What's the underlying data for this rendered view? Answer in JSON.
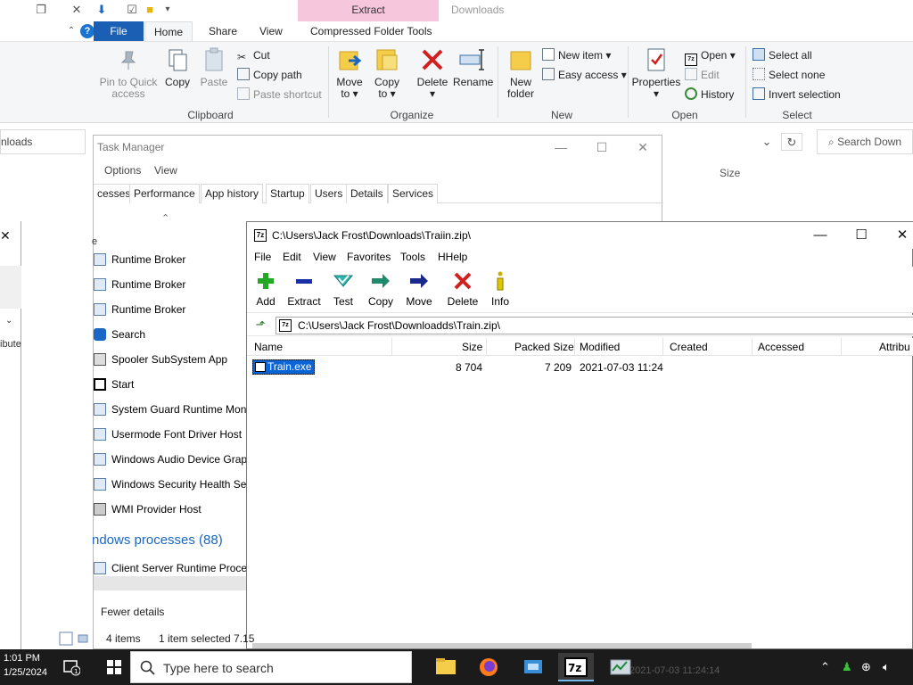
{
  "explorer": {
    "context_tab": "Extract",
    "window_title": "Downloads",
    "tabs": {
      "file": "File",
      "home": "Home",
      "share": "Share",
      "view": "View",
      "compressed": "Compressed Folder Tools"
    },
    "clipboard": {
      "pin": "Pin to Quick access",
      "copy": "Copy",
      "paste": "Paste",
      "cut": "Cut",
      "copy_path": "Copy path",
      "paste_shortcut": "Paste shortcut",
      "label": "Clipboard"
    },
    "organize": {
      "move_to": "Move to",
      "copy_to": "Copy to",
      "delete": "Delete",
      "rename": "Rename",
      "label": "Organize"
    },
    "new": {
      "new_folder": "New folder",
      "new_item": "New item",
      "easy_access": "Easy access",
      "label": "New"
    },
    "open": {
      "properties": "Properties",
      "open": "Open",
      "edit": "Edit",
      "history": "History",
      "label": "Open"
    },
    "select": {
      "select_all": "Select all",
      "select_none": "Select none",
      "invert": "Invert selection",
      "label": "Select"
    },
    "address_text": "nloads",
    "search_placeholder": "Search Down",
    "size_col": "Size",
    "status_items": "4 items",
    "status_selected": "1 item selected  7.15"
  },
  "taskmgr": {
    "title": "Task Manager",
    "menu": {
      "options": "Options",
      "view": "View"
    },
    "tabs": [
      "cesses",
      "Performance",
      "App history",
      "Startup",
      "Users",
      "Details",
      "Services"
    ],
    "name_col": "e",
    "processes": [
      "Runtime Broker",
      "Runtime Broker",
      "Runtime Broker",
      "Search",
      "Spooler SubSystem App",
      "Start",
      "System Guard Runtime Moni",
      "Usermode Font Driver Host",
      "Windows Audio Device Graph",
      "Windows Security Health Ser",
      "WMI Provider Host"
    ],
    "section_header": "ndows processes (88)",
    "section_first": "Client Server Runtime Proces",
    "fewer_details": "Fewer details"
  },
  "sevenzip": {
    "title": "C:\\Users\\Jack Frost\\Downloads\\Traiin.zip\\",
    "menu": {
      "file": "File",
      "edit": "Edit",
      "view": "View",
      "favorites": "Favorites",
      "tools": "Tools",
      "help": "HHelp"
    },
    "toolbar": {
      "add": "Add",
      "extract": "Extract",
      "test": "Test",
      "copy": "Copy",
      "move": "Move",
      "delete": "Delete",
      "info": "Info"
    },
    "path": "C:\\Users\\Jack Frost\\Downloadds\\Train.zip\\",
    "columns": {
      "name": "Name",
      "size": "Size",
      "packed": "Packed Size",
      "modified": "Modified",
      "created": "Created",
      "accessed": "Accessed",
      "attrib": "Attribu"
    },
    "row": {
      "name": "Train.exe",
      "size": "8 704",
      "packed": "7 209",
      "modified": "2021-07-03 11:24"
    }
  },
  "taskbar": {
    "time": "1:01 PM",
    "date": "1/25/2024",
    "search_placeholder": "Type here to search",
    "ghost_text": "2021-07-03 11:24:14"
  }
}
